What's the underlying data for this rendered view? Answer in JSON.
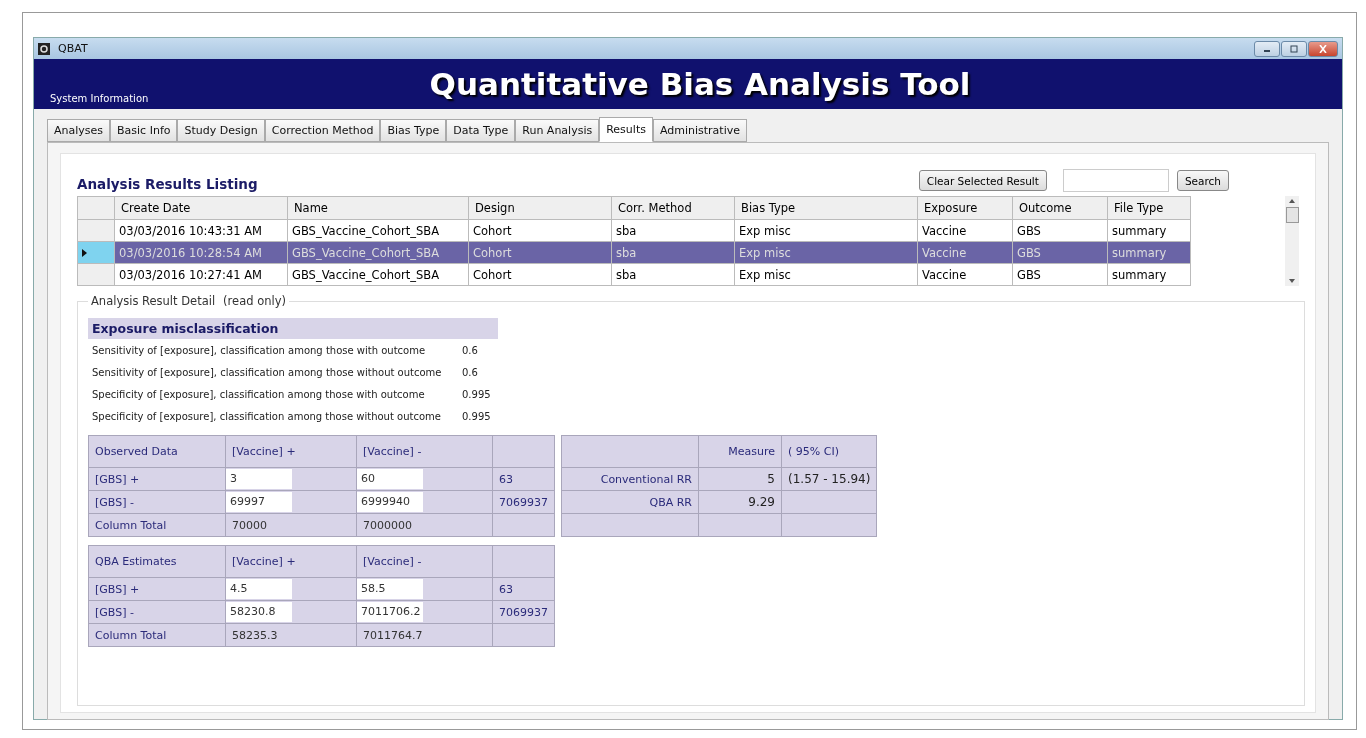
{
  "window": {
    "title": "QBAT"
  },
  "header": {
    "system_info": "System Information",
    "title": "Quantitative Bias Analysis Tool"
  },
  "tabs": [
    {
      "label": "Analyses",
      "selected": false
    },
    {
      "label": "Basic Info",
      "selected": false
    },
    {
      "label": "Study Design",
      "selected": false
    },
    {
      "label": "Correction Method",
      "selected": false
    },
    {
      "label": "Bias Type",
      "selected": false
    },
    {
      "label": "Data Type",
      "selected": false
    },
    {
      "label": "Run Analysis",
      "selected": false
    },
    {
      "label": "Results",
      "selected": true
    },
    {
      "label": "Administrative",
      "selected": false
    }
  ],
  "listing": {
    "title": "Analysis Results Listing",
    "clear_button": "Clear Selected Result",
    "search_button": "Search",
    "table": {
      "columns": [
        "Create Date",
        "Name",
        "Design",
        "Corr. Method",
        "Bias Type",
        "Exposure",
        "Outcome",
        "File Type"
      ],
      "rows": [
        {
          "selected": false,
          "cells": [
            "03/03/2016 10:43:31 AM",
            "GBS_Vaccine_Cohort_SBA",
            "Cohort",
            "sba",
            "Exp misc",
            "Vaccine",
            "GBS",
            "summary"
          ]
        },
        {
          "selected": true,
          "cells": [
            "03/03/2016 10:28:54 AM",
            "GBS_Vaccine_Cohort_SBA",
            "Cohort",
            "sba",
            "Exp misc",
            "Vaccine",
            "GBS",
            "summary"
          ]
        },
        {
          "selected": false,
          "cells": [
            "03/03/2016 10:27:41 AM",
            "GBS_Vaccine_Cohort_SBA",
            "Cohort",
            "sba",
            "Exp misc",
            "Vaccine",
            "GBS",
            "summary"
          ]
        }
      ]
    }
  },
  "detail": {
    "legend": "Analysis Result Detail",
    "legend_note": "(read only)",
    "parameters": {
      "heading": "Exposure misclassification",
      "rows": [
        {
          "label": "Sensitivity of [exposure], classification among those with outcome",
          "value": "0.6"
        },
        {
          "label": "Sensitivity of [exposure], classification among those without outcome",
          "value": "0.6"
        },
        {
          "label": "Specificity of [exposure], classification among those with outcome",
          "value": "0.995"
        },
        {
          "label": "Specificity of [exposure], classification among those without outcome",
          "value": "0.995"
        }
      ]
    },
    "tables": [
      {
        "header": [
          "Observed Data",
          "[Vaccine] +",
          "[Vaccine] -"
        ],
        "rows": [
          {
            "kind": "input",
            "label": "[GBS] +",
            "cells": [
              "3",
              "60"
            ],
            "total": "63"
          },
          {
            "kind": "input",
            "label": "[GBS] -",
            "cells": [
              "69997",
              "6999940"
            ],
            "total": "7069937"
          },
          {
            "kind": "total",
            "label": "Column Total",
            "cells": [
              "70000",
              "7000000"
            ]
          }
        ]
      },
      {
        "header": [
          "QBA Estimates",
          "[Vaccine] +",
          "[Vaccine] -"
        ],
        "rows": [
          {
            "kind": "input",
            "label": "[GBS] +",
            "cells": [
              "4.5",
              "58.5"
            ],
            "total": "63"
          },
          {
            "kind": "input",
            "label": "[GBS] -",
            "cells": [
              "58230.8",
              "7011706.2"
            ],
            "total": "7069937"
          },
          {
            "kind": "total",
            "label": "Column Total",
            "cells": [
              "58235.3",
              "7011764.7"
            ]
          }
        ]
      }
    ],
    "measures": {
      "columns": [
        "Measure",
        "( 95% CI)"
      ],
      "rows": [
        {
          "label": "Conventional RR",
          "measure": "5",
          "ci": "(1.57 - 15.94)"
        },
        {
          "label": "QBA RR",
          "measure": "9.29"
        }
      ]
    }
  }
}
